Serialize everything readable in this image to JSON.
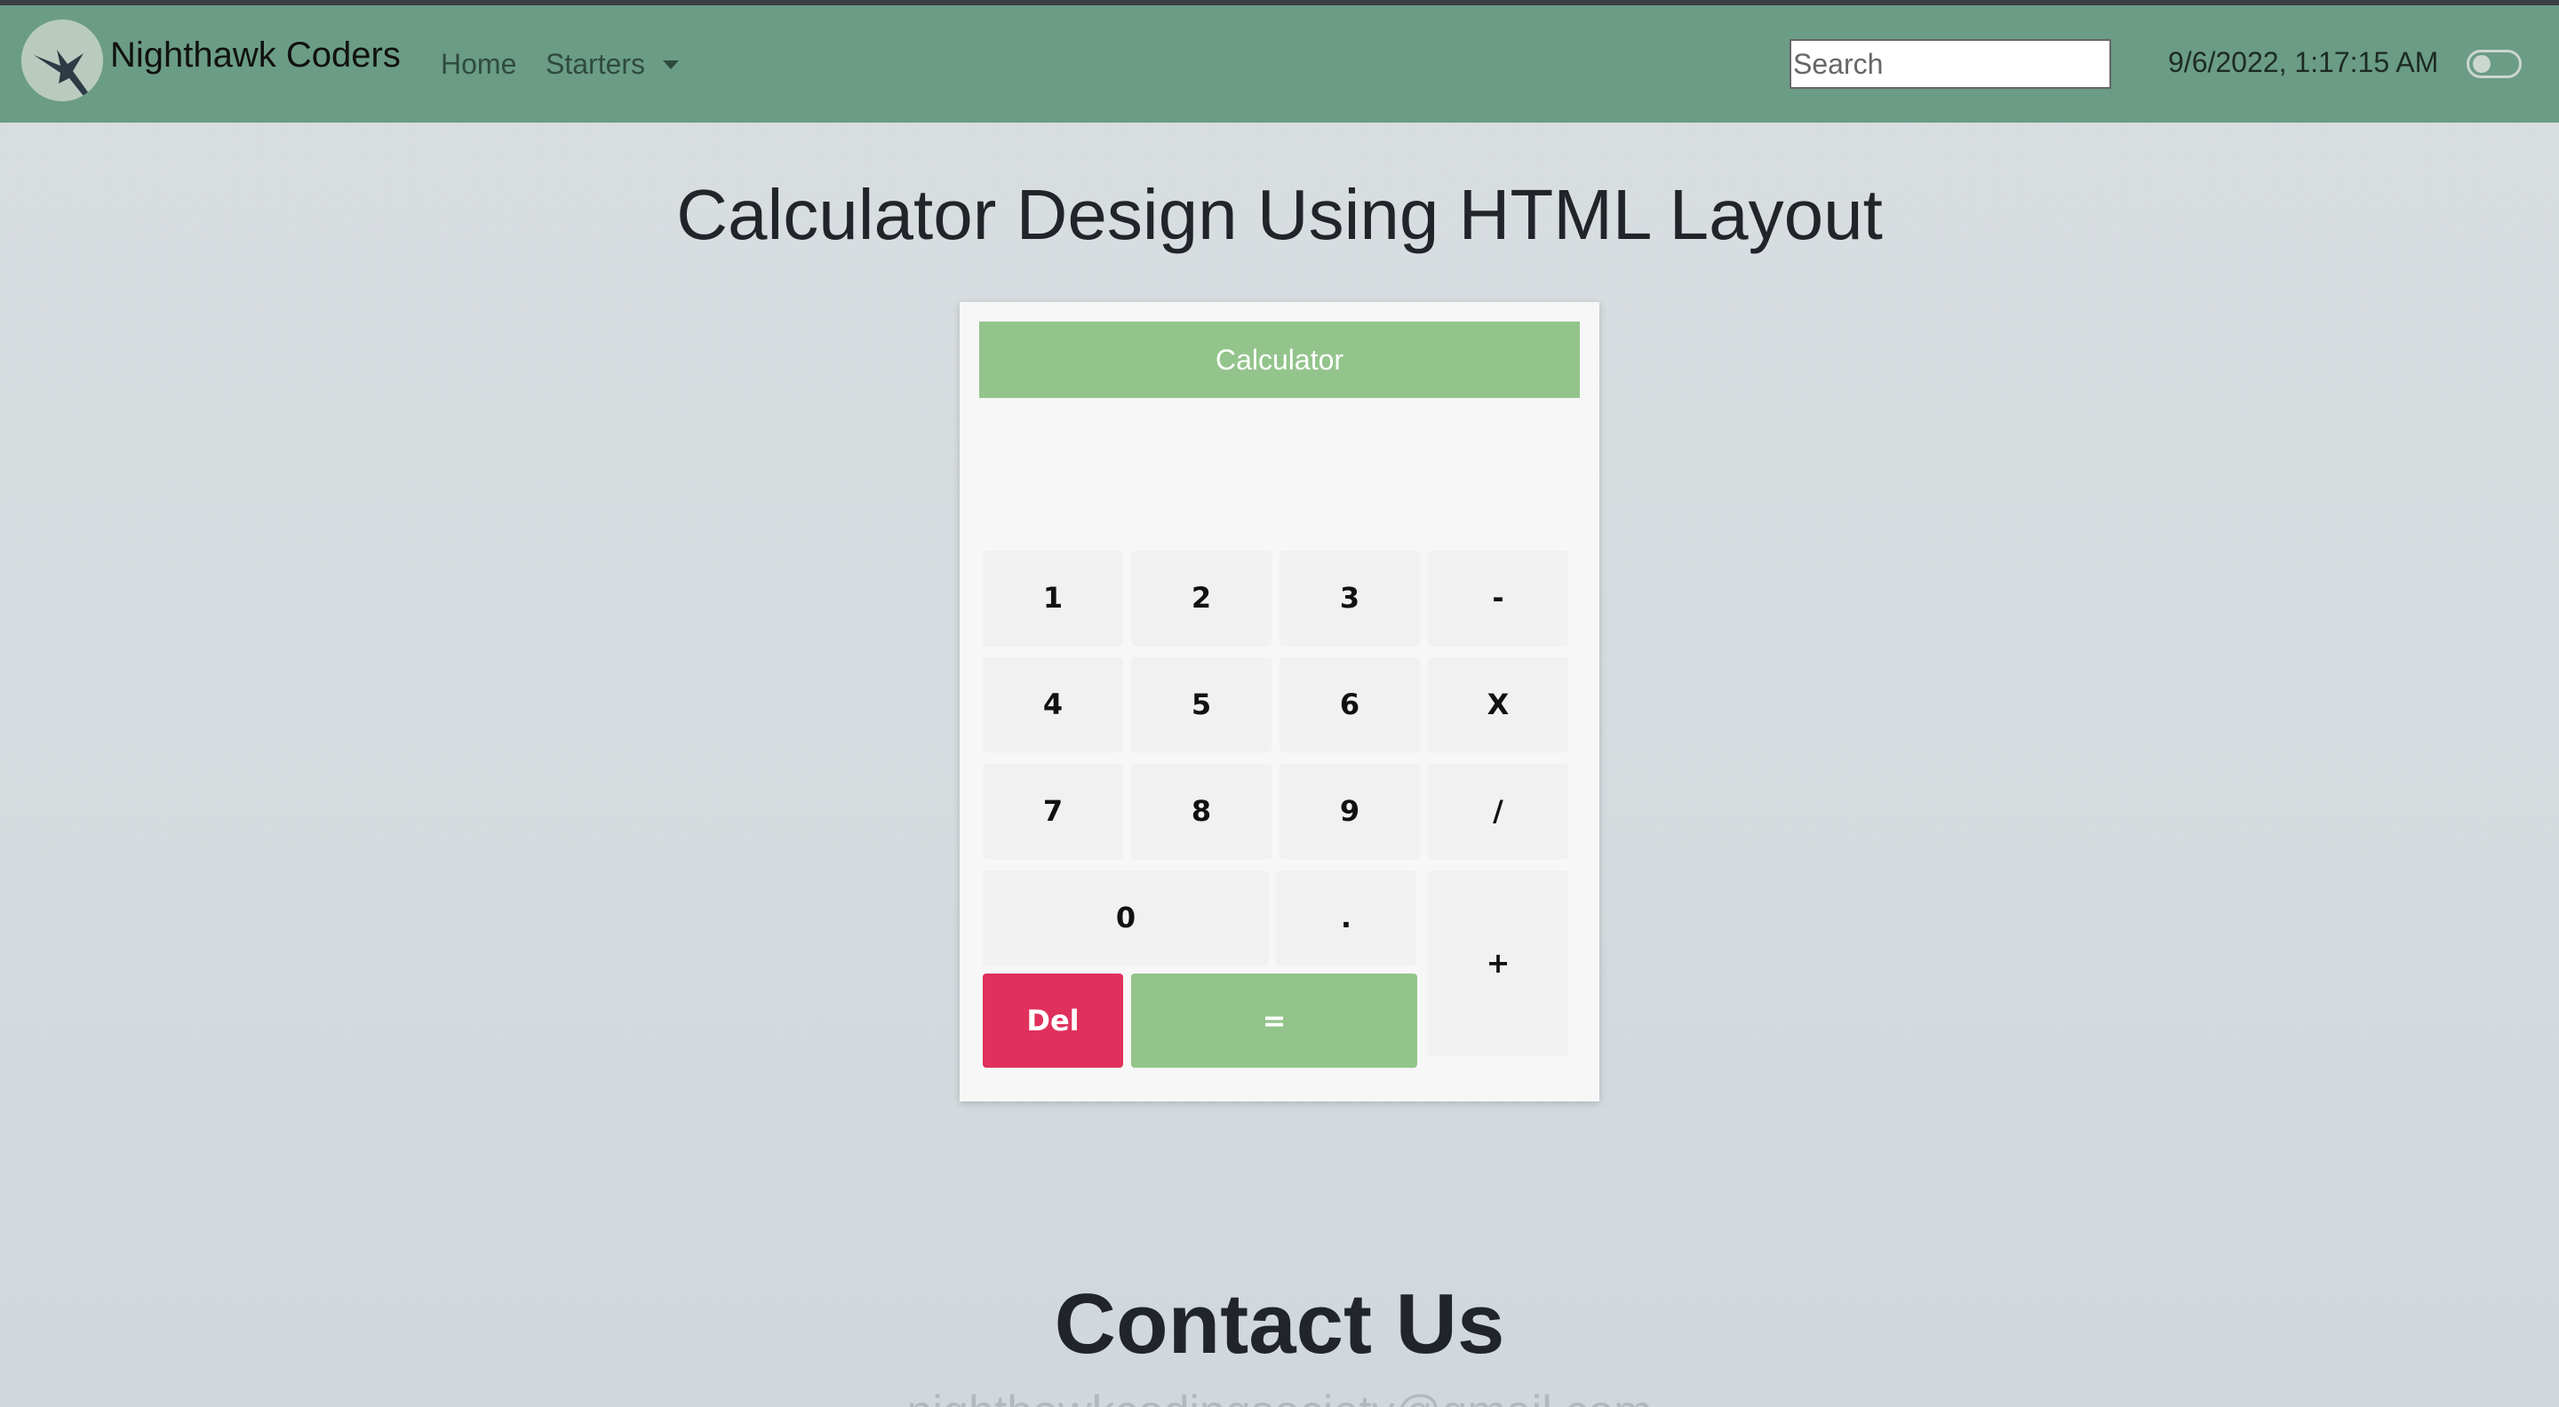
{
  "navbar": {
    "brand": "Nighthawk Coders",
    "links": {
      "home": "Home",
      "starters": "Starters"
    },
    "search_placeholder": "Search",
    "clock": "9/6/2022, 1:17:15 AM",
    "theme_toggle_on": false,
    "background_color": "#6b9c86"
  },
  "main": {
    "title": "Calculator Design Using HTML Layout"
  },
  "calculator": {
    "header": "Calculator",
    "display": "",
    "keys": {
      "k1": "1",
      "k2": "2",
      "k3": "3",
      "minus": "-",
      "k4": "4",
      "k5": "5",
      "k6": "6",
      "multiply": "X",
      "k7": "7",
      "k8": "8",
      "k9": "9",
      "divide": "/",
      "k0": "0",
      "dot": ".",
      "plus": "+",
      "del": "Del",
      "equals": "="
    },
    "colors": {
      "accent": "#93c48b",
      "delete": "#e0305c"
    }
  },
  "contact": {
    "title": "Contact Us",
    "email": "nighthawkcodingsociety@gmail.com"
  }
}
